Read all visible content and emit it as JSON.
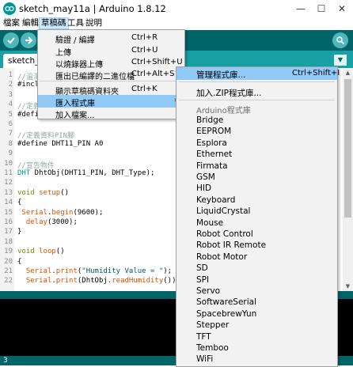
{
  "window": {
    "title": "sketch_may11a | Arduino 1.8.12",
    "minimize": "—",
    "maximize": "☐",
    "close": "✕"
  },
  "menubar": {
    "items": [
      "檔案",
      "編輯",
      "草稿碼",
      "工具",
      "說明"
    ],
    "active_index": 2
  },
  "tab": {
    "label": "sketch_m",
    "dropdown": "▼"
  },
  "editor": {
    "lines": [
      {
        "n": "1",
        "segments": [
          {
            "t": "//溫濕",
            "c": "c-comment"
          }
        ]
      },
      {
        "n": "2",
        "segments": [
          {
            "t": "#incl",
            "c": ""
          }
        ]
      },
      {
        "n": "3",
        "segments": []
      },
      {
        "n": "4",
        "segments": [
          {
            "t": "//定義",
            "c": "c-comment"
          }
        ]
      },
      {
        "n": "5",
        "segments": [
          {
            "t": "#defi",
            "c": ""
          }
        ]
      },
      {
        "n": "6",
        "segments": []
      },
      {
        "n": "7",
        "segments": [
          {
            "t": "//定義資料PIN腳",
            "c": "c-comment"
          }
        ]
      },
      {
        "n": "8",
        "segments": [
          {
            "t": "#define DHT11_PIN A0",
            "c": ""
          }
        ]
      },
      {
        "n": "9",
        "segments": []
      },
      {
        "n": "10",
        "segments": [
          {
            "t": "//宣告物件",
            "c": "c-comment"
          }
        ]
      },
      {
        "n": "11",
        "segments": [
          {
            "t": "DHT",
            "c": "c-type"
          },
          {
            "t": " DhtObj(DHT11_PIN, DHT_Type);",
            "c": ""
          }
        ]
      },
      {
        "n": "12",
        "segments": []
      },
      {
        "n": "13",
        "segments": [
          {
            "t": "void",
            "c": "c-kw"
          },
          {
            "t": " ",
            "c": ""
          },
          {
            "t": "setup",
            "c": "c-fn"
          },
          {
            "t": "()",
            "c": ""
          }
        ]
      },
      {
        "n": "14",
        "segments": [
          {
            "t": "{",
            "c": ""
          }
        ]
      },
      {
        "n": "15",
        "segments": [
          {
            "t": " ",
            "c": ""
          },
          {
            "t": "Serial",
            "c": "c-fn"
          },
          {
            "t": ".",
            "c": ""
          },
          {
            "t": "begin",
            "c": "c-fn"
          },
          {
            "t": "(9600);",
            "c": ""
          }
        ]
      },
      {
        "n": "16",
        "segments": [
          {
            "t": "  ",
            "c": ""
          },
          {
            "t": "delay",
            "c": "c-fn"
          },
          {
            "t": "(3000);",
            "c": ""
          }
        ]
      },
      {
        "n": "17",
        "segments": [
          {
            "t": "}",
            "c": ""
          }
        ]
      },
      {
        "n": "18",
        "segments": []
      },
      {
        "n": "19",
        "segments": [
          {
            "t": "void",
            "c": "c-kw"
          },
          {
            "t": " ",
            "c": ""
          },
          {
            "t": "loop",
            "c": "c-fn"
          },
          {
            "t": "()",
            "c": ""
          }
        ]
      },
      {
        "n": "20",
        "segments": [
          {
            "t": "{",
            "c": ""
          }
        ]
      },
      {
        "n": "21",
        "segments": [
          {
            "t": "  ",
            "c": ""
          },
          {
            "t": "Serial",
            "c": "c-fn"
          },
          {
            "t": ".",
            "c": ""
          },
          {
            "t": "print",
            "c": "c-fn"
          },
          {
            "t": "(",
            "c": ""
          },
          {
            "t": "\"Humidity Value = \"",
            "c": "c-str"
          },
          {
            "t": ");",
            "c": ""
          }
        ]
      },
      {
        "n": "22",
        "segments": [
          {
            "t": "  ",
            "c": ""
          },
          {
            "t": "Serial",
            "c": "c-fn"
          },
          {
            "t": ".",
            "c": ""
          },
          {
            "t": "print",
            "c": "c-fn"
          },
          {
            "t": "(DhtObj.",
            "c": ""
          },
          {
            "t": "readHumidity",
            "c": "c-fn"
          },
          {
            "t": "());",
            "c": ""
          }
        ]
      }
    ]
  },
  "sketch_menu": {
    "items": [
      {
        "label": "驗證 / 編譯",
        "shortcut": "Ctrl+R"
      },
      {
        "label": "上傳",
        "shortcut": "Ctrl+U"
      },
      {
        "label": "以燒錄器上傳",
        "shortcut": "Ctrl+Shift+U"
      },
      {
        "label": "匯出已編譯的二進位檔",
        "shortcut": "Ctrl+Alt+S"
      },
      {
        "label": "顯示草稿碼資料夾",
        "shortcut": "Ctrl+K"
      },
      {
        "label": "匯入程式庫",
        "shortcut": ""
      },
      {
        "label": "加入檔案...",
        "shortcut": ""
      }
    ],
    "submenu_arrow": "›"
  },
  "library_menu": {
    "manage": {
      "label": "管理程式庫...",
      "shortcut": "Ctrl+Shift+I"
    },
    "add_zip": "加入.ZIP程式庫...",
    "section_header": "Arduino程式庫",
    "libraries": [
      "Bridge",
      "EEPROM",
      "Esplora",
      "Ethernet",
      "Firmata",
      "GSM",
      "HID",
      "Keyboard",
      "LiquidCrystal",
      "Mouse",
      "Robot Control",
      "Robot IR Remote",
      "Robot Motor",
      "SD",
      "SPI",
      "Servo",
      "SoftwareSerial",
      "SpacebrewYun",
      "Stepper",
      "TFT",
      "Temboo",
      "WiFi"
    ]
  },
  "status": {
    "line": "3",
    "right": ""
  },
  "colors": {
    "toolbar": "#006468",
    "tabstrip": "#17a1a5",
    "highlight": "#91c9f7"
  }
}
